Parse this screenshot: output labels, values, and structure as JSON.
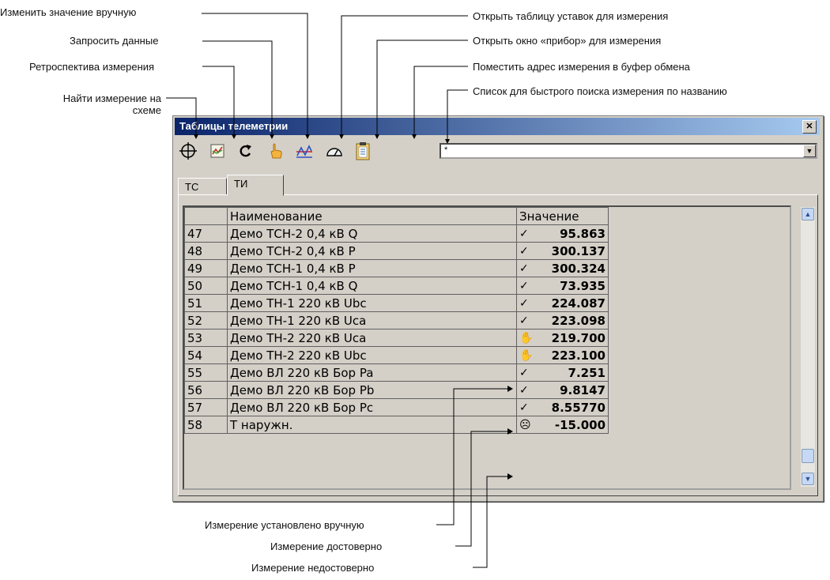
{
  "annotations": {
    "change_manual": "Изменить значение вручную",
    "request_data": "Запросить данные",
    "retrospective": "Ретроспектива измерения",
    "find_on_scheme_line1": "Найти измерение на",
    "find_on_scheme_line2": "схеме",
    "open_setpoints": "Открыть таблицу уставок для измерения",
    "open_device": "Открыть окно «прибор» для измерения",
    "copy_address": "Поместить адрес измерения в буфер обмена",
    "quick_search": "Список для быстрого поиска измерения по названию",
    "set_manual": "Измерение установлено вручную",
    "reliable": "Измерение достоверно",
    "unreliable": "Измерение недостоверно"
  },
  "window": {
    "title": "Таблицы телеметрии",
    "close_label": "✕"
  },
  "toolbar": {
    "icons": [
      "crosshair-icon",
      "chart-icon",
      "refresh-icon",
      "hand-icon",
      "setpoints-icon",
      "gauge-icon",
      "clipboard-icon"
    ],
    "search_value": "*"
  },
  "tabs": [
    {
      "label": "ТС",
      "active": false
    },
    {
      "label": "ТИ",
      "active": true
    }
  ],
  "table": {
    "headers": [
      "",
      "Наименование",
      "Значение"
    ],
    "rows": [
      {
        "idx": "47",
        "name": "Демо ТСН-2 0,4 кВ Q",
        "status": "✓",
        "value": "95.863"
      },
      {
        "idx": "48",
        "name": "Демо ТСН-2 0,4 кВ P",
        "status": "✓",
        "value": "300.137"
      },
      {
        "idx": "49",
        "name": "Демо ТСН-1 0,4 кВ P",
        "status": "✓",
        "value": "300.324"
      },
      {
        "idx": "50",
        "name": "Демо ТСН-1 0,4 кВ Q",
        "status": "✓",
        "value": "73.935"
      },
      {
        "idx": "51",
        "name": "Демо ТН-1 220 кВ Ubc",
        "status": "✓",
        "value": "224.087"
      },
      {
        "idx": "52",
        "name": "Демо ТН-1 220 кВ Uca",
        "status": "✓",
        "value": "223.098"
      },
      {
        "idx": "53",
        "name": "Демо ТН-2 220 кВ Uca",
        "status": "✋",
        "value": "219.700"
      },
      {
        "idx": "54",
        "name": "Демо ТН-2 220 кВ Ubc",
        "status": "✋",
        "value": "223.100"
      },
      {
        "idx": "55",
        "name": "Демо ВЛ 220 кВ Бор Pa",
        "status": "✓",
        "value": "7.251"
      },
      {
        "idx": "56",
        "name": "Демо ВЛ 220 кВ Бор Pb",
        "status": "✓",
        "value": "9.8147"
      },
      {
        "idx": "57",
        "name": "Демо ВЛ 220 кВ Бор Pc",
        "status": "✓",
        "value": "8.55770"
      },
      {
        "idx": "58",
        "name": "Т наружн.",
        "status": "☹",
        "value": "-15.000"
      }
    ]
  },
  "colors": {
    "titlebar_start": "#0a246a",
    "titlebar_end": "#a6caf0",
    "window_bg": "#d4d0c8"
  }
}
